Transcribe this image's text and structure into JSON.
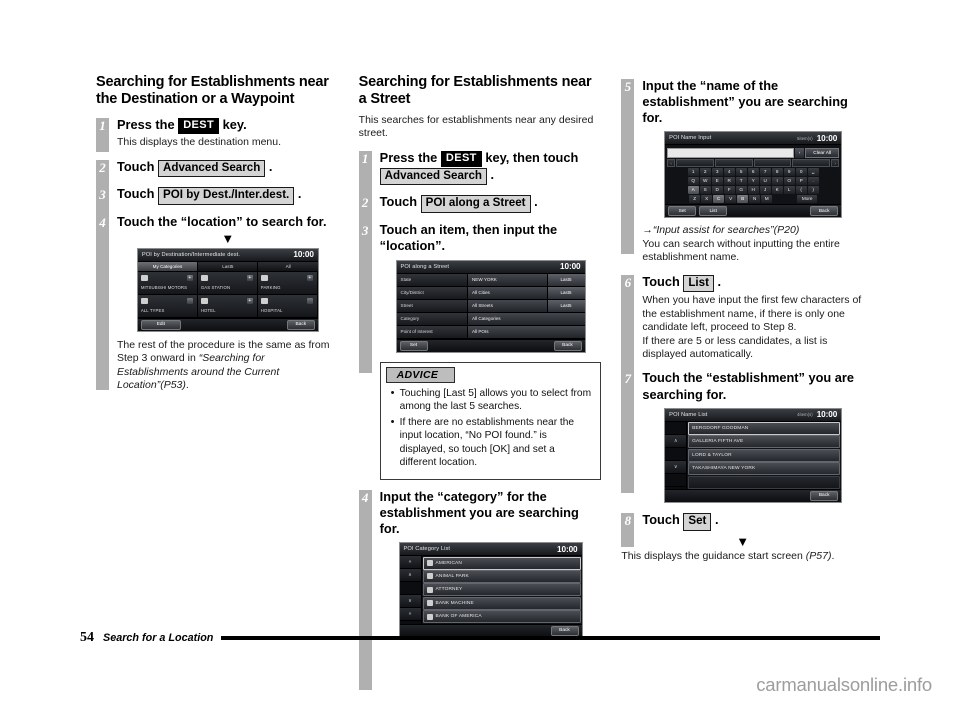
{
  "document": {
    "page_number": "54",
    "footer_title": "Search for a Location",
    "watermark": "carmanualsonline.info"
  },
  "column1": {
    "title": "Searching for Establishments near the Destination or a Waypoint",
    "steps": [
      {
        "num": "1",
        "head_pre": "Press the ",
        "key": "DEST",
        "head_post": " key.",
        "body": "This displays the destination menu."
      },
      {
        "num": "2",
        "head_pre": "Touch ",
        "chip": "Advanced Search",
        "head_post": " ."
      },
      {
        "num": "3",
        "head_pre": "Touch ",
        "chip": "POI by Dest./Inter.dest.",
        "head_post": " ."
      },
      {
        "num": "4",
        "head": "Touch the “location” to search for."
      }
    ],
    "arrow": "▼",
    "note_line1": "The rest of the procedure is the same",
    "note_line2": "as from Step 3 onward in ",
    "note_italic": "“Searching for Establishments around the Current Location”(P53)",
    "note_end": "."
  },
  "screen_poi_by_dest": {
    "title": "POI by Destination/Intermediate dest.",
    "clock": "10:00",
    "tabs": [
      "My Categories",
      "Last5",
      "All"
    ],
    "active_tab_index": 0,
    "cells": [
      {
        "label": "MITSUBISHI MOTORS",
        "icon": "book-icon",
        "plus": "+"
      },
      {
        "label": "GAS STATION",
        "icon": "fuel-icon",
        "plus": "+"
      },
      {
        "label": "PARKING",
        "icon": "parking-icon",
        "plus": "+"
      },
      {
        "label": "ALL TYPES",
        "icon": "grid-icon",
        "plus": ""
      },
      {
        "label": "HOTEL",
        "icon": "bed-icon",
        "plus": "+"
      },
      {
        "label": "HOSPITAL",
        "icon": "cross-icon",
        "plus": ""
      }
    ],
    "footer_left": "Edit",
    "footer_right": "Back"
  },
  "column2": {
    "title": "Searching for Establishments near a Street",
    "intro": "This searches for establishments near any desired street.",
    "steps": [
      {
        "num": "1",
        "head_pre": "Press the ",
        "key": "DEST",
        "head_mid": " key, then touch ",
        "chip": "Advanced Search",
        "head_post": " ."
      },
      {
        "num": "2",
        "head_pre": "Touch ",
        "chip": "POI along a Street",
        "head_post": " ."
      },
      {
        "num": "3",
        "head": "Touch an item, then input the “location”."
      },
      {
        "num": "4",
        "head": "Input the “category” for the establishment you are searching for."
      }
    ],
    "advice": {
      "label": "ADVICE",
      "items": [
        "Touching [Last 5] allows you to select from among the last 5 searches.",
        "If there are no establishments near the input location, “No POI found.” is displayed, so touch [OK] and set a different location."
      ]
    }
  },
  "screen_poi_along_street": {
    "title": "POI along a Street",
    "clock": "10:00",
    "rows": [
      {
        "label": "State",
        "value": "NEW YORK",
        "button": "Last5"
      },
      {
        "label": "City/District",
        "value": "All Cities",
        "button": "Last5"
      },
      {
        "label": "Street",
        "value": "All Streets",
        "button": "Last5"
      },
      {
        "label": "Category",
        "value": "All Categories",
        "button": ""
      },
      {
        "label": "Point of Interest",
        "value": "All POIs",
        "button": ""
      }
    ],
    "footer_left": "Set",
    "footer_right": "Back"
  },
  "screen_poi_category_list": {
    "title": "POI Category List",
    "clock": "10:00",
    "scroll_buttons": [
      "«",
      "∧",
      "",
      "∨",
      "»"
    ],
    "rows": [
      "AMERICAN",
      "ANIMAL PARK",
      "ATTORNEY",
      "BANK MACHINE",
      "BANK OF AMERICA"
    ],
    "footer_right": "Back"
  },
  "column3": {
    "steps": [
      {
        "num": "5",
        "head": "Input the “name of the establishment” you are searching for."
      },
      {
        "num": "6",
        "head_pre": "Touch ",
        "chip": "List",
        "head_post": " .",
        "body": "When you have input the first few characters of the establishment name, if there is only one candidate left, proceed to Step 8.\nIf there are 5 or less candidates, a list is displayed automatically."
      },
      {
        "num": "7",
        "head": "Touch the “establishment” you are searching for."
      },
      {
        "num": "8",
        "head_pre": "Touch ",
        "chip": "Set",
        "head_post": " ."
      }
    ],
    "ref_link": "→“Input assist for searches”(P20)",
    "ref_body": "You can search without inputting the entire establishment name.",
    "arrow": "▼",
    "closing_pre": "This displays the guidance start screen ",
    "closing_italic": "(P57)",
    "closing_post": "."
  },
  "screen_poi_name_input": {
    "title": "POI Name Input",
    "items_label": "5item(s)",
    "clock": "10:00",
    "input_value": "",
    "backspace": "‹",
    "clear_all": "Clear All",
    "rows": [
      [
        "1",
        "2",
        "3",
        "4",
        "5",
        "6",
        "7",
        "8",
        "9",
        "0",
        "␣"
      ],
      [
        "Q",
        "W",
        "E",
        "R",
        "T",
        "Y",
        "U",
        "I",
        "O",
        "P",
        "."
      ],
      [
        "A",
        "S",
        "D",
        "F",
        "G",
        "H",
        "J",
        "K",
        "L",
        "(",
        ")"
      ],
      [
        "Z",
        "X",
        "C",
        "V",
        "B",
        "N",
        "M",
        "More"
      ]
    ],
    "lit_keys": [
      "A",
      "C",
      "B"
    ],
    "footer_set": "Set",
    "footer_list": "List",
    "footer_back": "Back"
  },
  "screen_poi_name_list": {
    "title": "POI Name List",
    "items_label": "4item(s)",
    "clock": "10:00",
    "scroll_buttons": [
      "",
      "∧",
      "",
      "∨",
      ""
    ],
    "rows": [
      "BERGDORF GOODMAN",
      "GALLERIA FIFTH AVE",
      "LORD & TAYLOR",
      "TAKASHIMAYA NEW YORK",
      ""
    ],
    "footer_right": "Back"
  }
}
